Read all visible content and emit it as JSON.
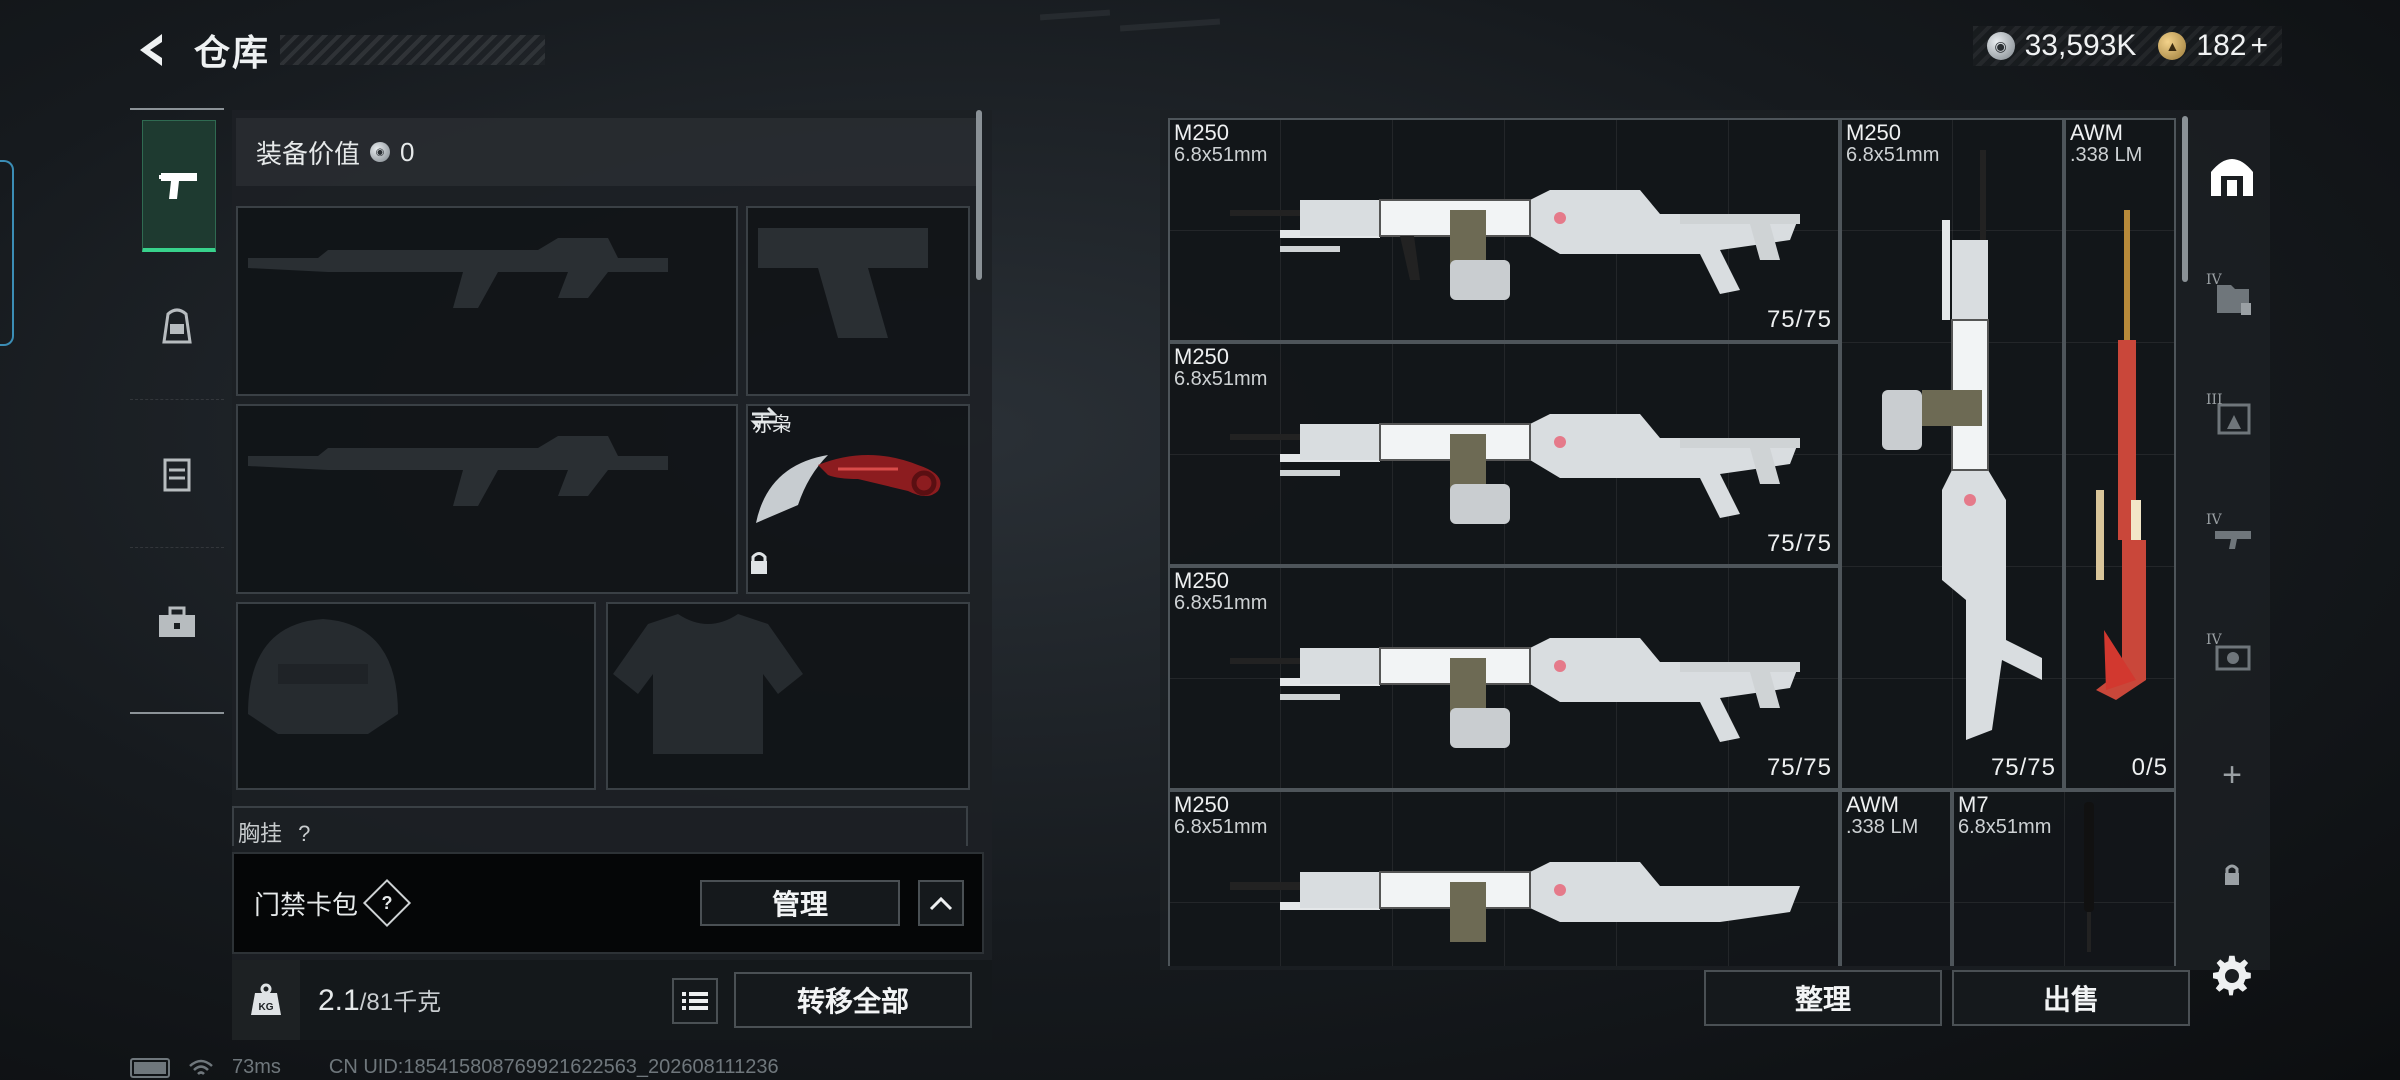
{
  "header": {
    "title": "仓库",
    "currency": [
      {
        "icon": "silver-coin-icon",
        "value": "33,593K"
      },
      {
        "icon": "gold-coin-icon",
        "value": "182"
      }
    ],
    "add_symbol": "+"
  },
  "left_tabs": [
    {
      "name": "weapons-tab",
      "icon": "pistol-icon",
      "active": true
    },
    {
      "name": "gear-tab",
      "icon": "backpack-icon",
      "active": false
    },
    {
      "name": "rig-tab",
      "icon": "chest-rig-icon",
      "active": false
    },
    {
      "name": "tools-tab",
      "icon": "toolbox-icon",
      "active": false
    }
  ],
  "loadout": {
    "equip_value_label": "装备价值",
    "equip_value": "0",
    "melee_slot_name": "赤枭",
    "next_slot_label": "胸挂",
    "next_slot_badge": "?"
  },
  "keycard": {
    "label": "门禁卡包",
    "help": "?",
    "manage_label": "管理"
  },
  "weight": {
    "current": "2.1",
    "max": "/81千克",
    "kg_icon_text": "KG"
  },
  "transfer_all_label": "转移全部",
  "stash": {
    "items": [
      {
        "id": "m250-1",
        "name": "M250",
        "caliber": "6.8x51mm",
        "count": "75/75"
      },
      {
        "id": "m250-2",
        "name": "M250",
        "caliber": "6.8x51mm",
        "count": "75/75"
      },
      {
        "id": "m250-3",
        "name": "M250",
        "caliber": "6.8x51mm",
        "count": "75/75"
      },
      {
        "id": "m250-4",
        "name": "M250",
        "caliber": "6.8x51mm",
        "count": ""
      },
      {
        "id": "m250-vertical",
        "name": "M250",
        "caliber": "6.8x51mm",
        "count": "75/75"
      },
      {
        "id": "awm-1",
        "name": "AWM",
        "caliber": ".338 LM",
        "count": "0/5"
      },
      {
        "id": "awm-2",
        "name": "AWM",
        "caliber": ".338 LM",
        "count": ""
      },
      {
        "id": "m7",
        "name": "M7",
        "caliber": "6.8x51mm",
        "count": ""
      }
    ],
    "sort_label": "整理",
    "sell_label": "出售",
    "side_tabs": [
      {
        "icon": "safe-box-icon",
        "roman": ""
      },
      {
        "icon": "stash-iv-folder-icon",
        "roman": "IV"
      },
      {
        "icon": "stash-iii-icon",
        "roman": "III"
      },
      {
        "icon": "stash-iv-gun-icon",
        "roman": "IV"
      },
      {
        "icon": "stash-iv-camera-icon",
        "roman": "IV"
      }
    ],
    "add_tab": "+"
  },
  "status": {
    "ping": "73ms",
    "uid": "CN UID:185415808769921622563_202608111236"
  }
}
